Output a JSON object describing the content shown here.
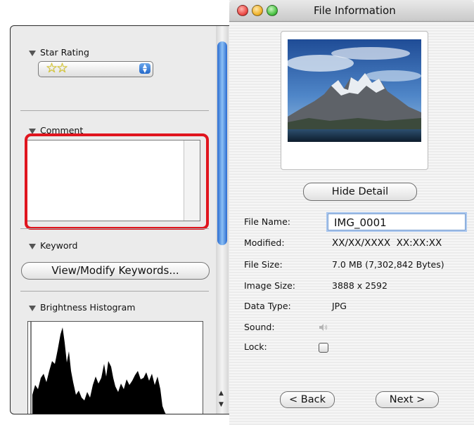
{
  "window": {
    "title": "File Information"
  },
  "left_panel": {
    "star_rating": {
      "label": "Star Rating",
      "value": "☆☆"
    },
    "comment": {
      "label": "Comment",
      "value": ""
    },
    "keyword": {
      "label": "Keyword",
      "button_label": "View/Modify Keywords..."
    },
    "histogram": {
      "label": "Brightness Histogram"
    }
  },
  "info": {
    "hide_detail_label": "Hide Detail",
    "fields": {
      "file_name": {
        "label": "File Name:",
        "value": "IMG_0001"
      },
      "modified": {
        "label": "Modified:",
        "value": "XX/XX/XXXX  XX:XX:XX"
      },
      "file_size": {
        "label": "File Size:",
        "value": "7.0 MB (7,302,842 Bytes)"
      },
      "image_size": {
        "label": "Image Size:",
        "value": "3888 x 2592"
      },
      "data_type": {
        "label": "Data Type:",
        "value": "JPG"
      },
      "sound": {
        "label": "Sound:",
        "icon": "speaker-icon"
      },
      "lock": {
        "label": "Lock:",
        "checked": false
      }
    },
    "back_label": "< Back",
    "next_label": "Next >"
  },
  "colors": {
    "highlight": "#e0151e",
    "scroll_accent": "#2a6bd0",
    "close_light": "#ec4e4a",
    "minimize_light": "#f0b52f",
    "zoom_light": "#4ec447"
  }
}
